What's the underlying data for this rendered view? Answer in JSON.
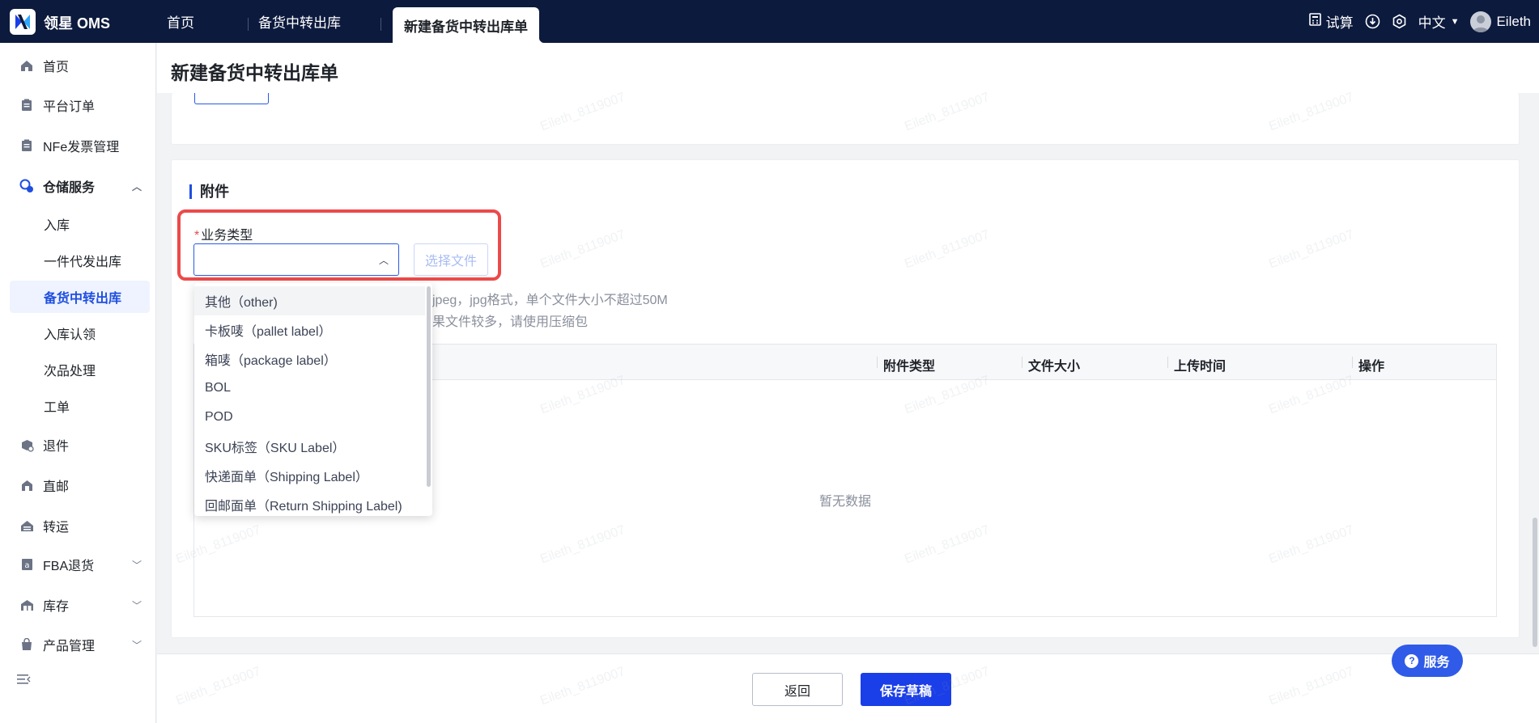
{
  "app": {
    "name": "领星 OMS"
  },
  "tabs": [
    {
      "label": "首页"
    },
    {
      "label": "备货中转出库"
    },
    {
      "label": "新建备货中转出库单"
    }
  ],
  "topbar": {
    "trial": "试算",
    "language": "中文",
    "user": "Eileth"
  },
  "sidebar": {
    "items": [
      {
        "label": "首页"
      },
      {
        "label": "平台订单"
      },
      {
        "label": "NFe发票管理"
      },
      {
        "label": "仓储服务"
      },
      {
        "label": "入库"
      },
      {
        "label": "一件代发出库"
      },
      {
        "label": "备货中转出库"
      },
      {
        "label": "入库认领"
      },
      {
        "label": "次品处理"
      },
      {
        "label": "工单"
      },
      {
        "label": "退件"
      },
      {
        "label": "直邮"
      },
      {
        "label": "转运"
      },
      {
        "label": "FBA退货"
      },
      {
        "label": "库存"
      },
      {
        "label": "产品管理"
      }
    ]
  },
  "page": {
    "title": "新建备货中转出库单"
  },
  "attachment": {
    "section_title": "附件",
    "business_type_label": "业务类型",
    "choose_file": "选择文件",
    "hint_line1": "jpeg，jpg格式，单个文件大小不超过50M",
    "hint_line2": "果文件较多，请使用压缩包",
    "table_headers": [
      "附件类型",
      "文件大小",
      "上传时间",
      "操作"
    ],
    "empty_text": "暂无数据"
  },
  "dropdown": {
    "options": [
      "其他（other)",
      "卡板唛（pallet label）",
      "箱唛（package label）",
      "BOL",
      "POD",
      "SKU标签（SKU Label）",
      "快递面单（Shipping Label）",
      "回邮面单（Return Shipping Label)"
    ]
  },
  "footer": {
    "back": "返回",
    "save_draft": "保存草稿"
  },
  "service": {
    "label": "服务"
  },
  "watermark": "Eileth_8119007"
}
